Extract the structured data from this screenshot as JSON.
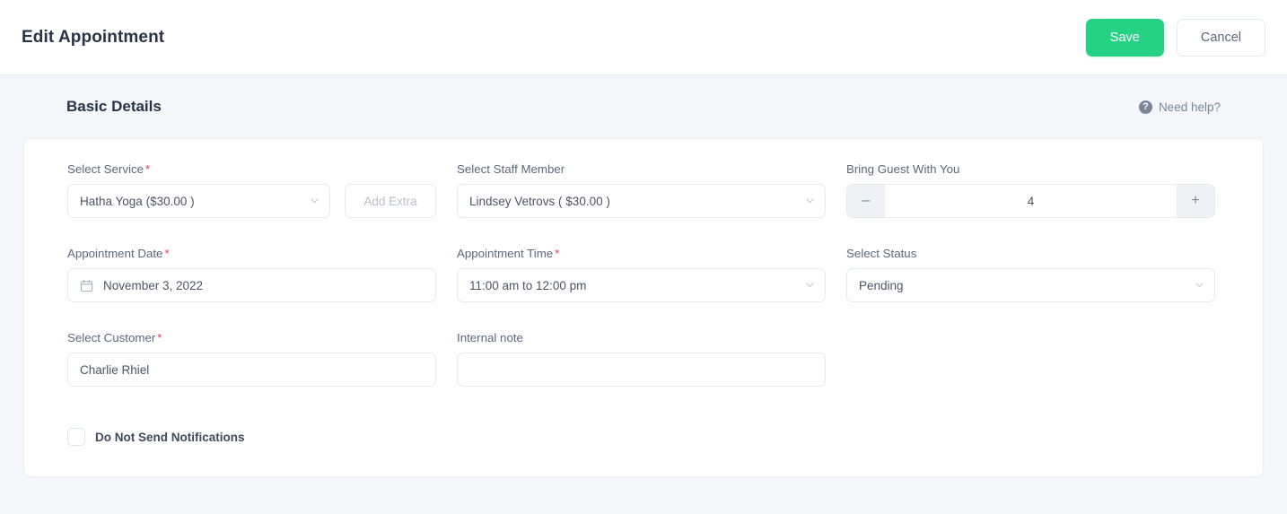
{
  "header": {
    "title": "Edit Appointment",
    "save_label": "Save",
    "cancel_label": "Cancel",
    "save_color": "#25d283"
  },
  "section": {
    "title": "Basic Details",
    "need_help_label": "Need help?",
    "help_icon": "question-circle-icon"
  },
  "fields": {
    "service": {
      "label": "Select Service",
      "required": "*",
      "value": "Hatha Yoga ($30.00 )",
      "add_extra_label": "Add Extra"
    },
    "staff": {
      "label": "Select Staff Member",
      "value": "Lindsey Vetrovs ( $30.00 )"
    },
    "guests": {
      "label": "Bring Guest With You",
      "value": "4",
      "decrement_label": "–",
      "increment_label": "+"
    },
    "date": {
      "label": "Appointment Date",
      "required": "*",
      "value": "November 3, 2022",
      "icon": "calendar-icon"
    },
    "time": {
      "label": "Appointment Time",
      "required": "*",
      "value": "11:00 am to 12:00 pm"
    },
    "status": {
      "label": "Select Status",
      "value": "Pending"
    },
    "customer": {
      "label": "Select Customer",
      "required": "*",
      "value": "Charlie Rhiel"
    },
    "note": {
      "label": "Internal note",
      "value": "",
      "placeholder": ""
    },
    "no_notifications": {
      "label": "Do Not Send Notifications",
      "checked": "false"
    }
  }
}
